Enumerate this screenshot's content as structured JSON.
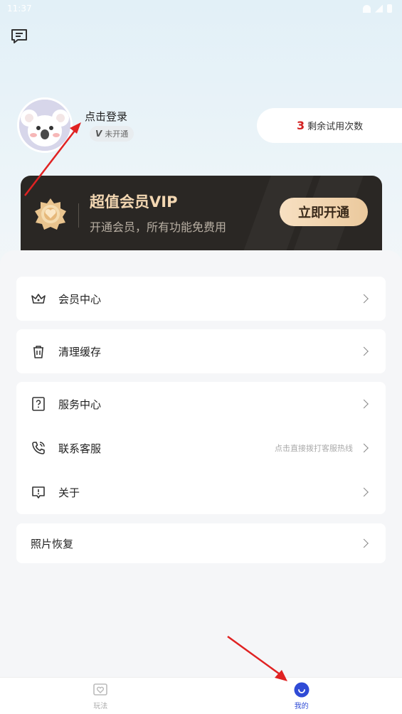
{
  "status_bar": {
    "time": "11:37"
  },
  "profile": {
    "login_label": "点击登录",
    "vip_badge_mark": "V",
    "vip_badge_text": "未开通"
  },
  "trial": {
    "count": "3",
    "label": "剩余试用次数"
  },
  "vip_banner": {
    "title": "超值会员VIP",
    "subtitle": "开通会员，所有功能免费用",
    "button": "立即开通"
  },
  "menu": {
    "vip_center": "会员中心",
    "clear_cache": "清理缓存",
    "service_center": "服务中心",
    "contact_support": "联系客服",
    "contact_hint": "点击直接拨打客服热线",
    "about": "关于",
    "photo_recovery": "照片恢复"
  },
  "tabbar": {
    "play": "玩法",
    "mine": "我的"
  },
  "colors": {
    "accent": "#2f4bd6",
    "trial_count": "#d32121",
    "vip_gold": "#f3d7b2"
  }
}
